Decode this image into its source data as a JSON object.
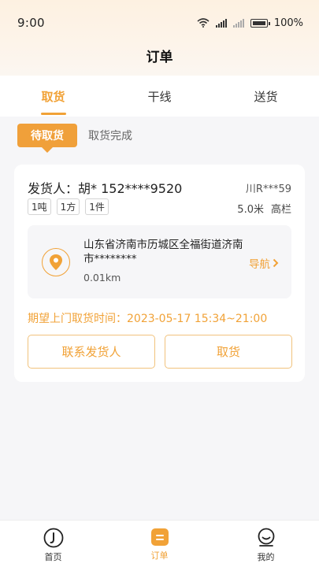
{
  "status_bar": {
    "time": "9:00",
    "battery": "100%"
  },
  "page_title": "订单",
  "main_tabs": [
    {
      "label": "取货",
      "active": true
    },
    {
      "label": "干线",
      "active": false
    },
    {
      "label": "送货",
      "active": false
    }
  ],
  "sub_tabs": {
    "active": "待取货",
    "other": "取货完成"
  },
  "order": {
    "shipper": "发货人：胡*   152****9520",
    "plate": "川R***59",
    "tags": [
      "1吨",
      "1方",
      "1件"
    ],
    "truck_length": "5.0米",
    "truck_type": "高栏",
    "address": "山东省济南市历城区全福街道济南市********",
    "distance": "0.01km",
    "navigate": "导航",
    "expected_time": "期望上门取货时间：2023-05-17 15:34~21:00",
    "contact_button": "联系发货人",
    "pickup_button": "取货"
  },
  "bottom_nav": [
    {
      "label": "首页",
      "icon": "home-icon"
    },
    {
      "label": "订单",
      "icon": "order-icon",
      "active": true
    },
    {
      "label": "我的",
      "icon": "profile-icon"
    }
  ],
  "colors": {
    "accent": "#f1a237",
    "background": "#f6f6f8"
  }
}
